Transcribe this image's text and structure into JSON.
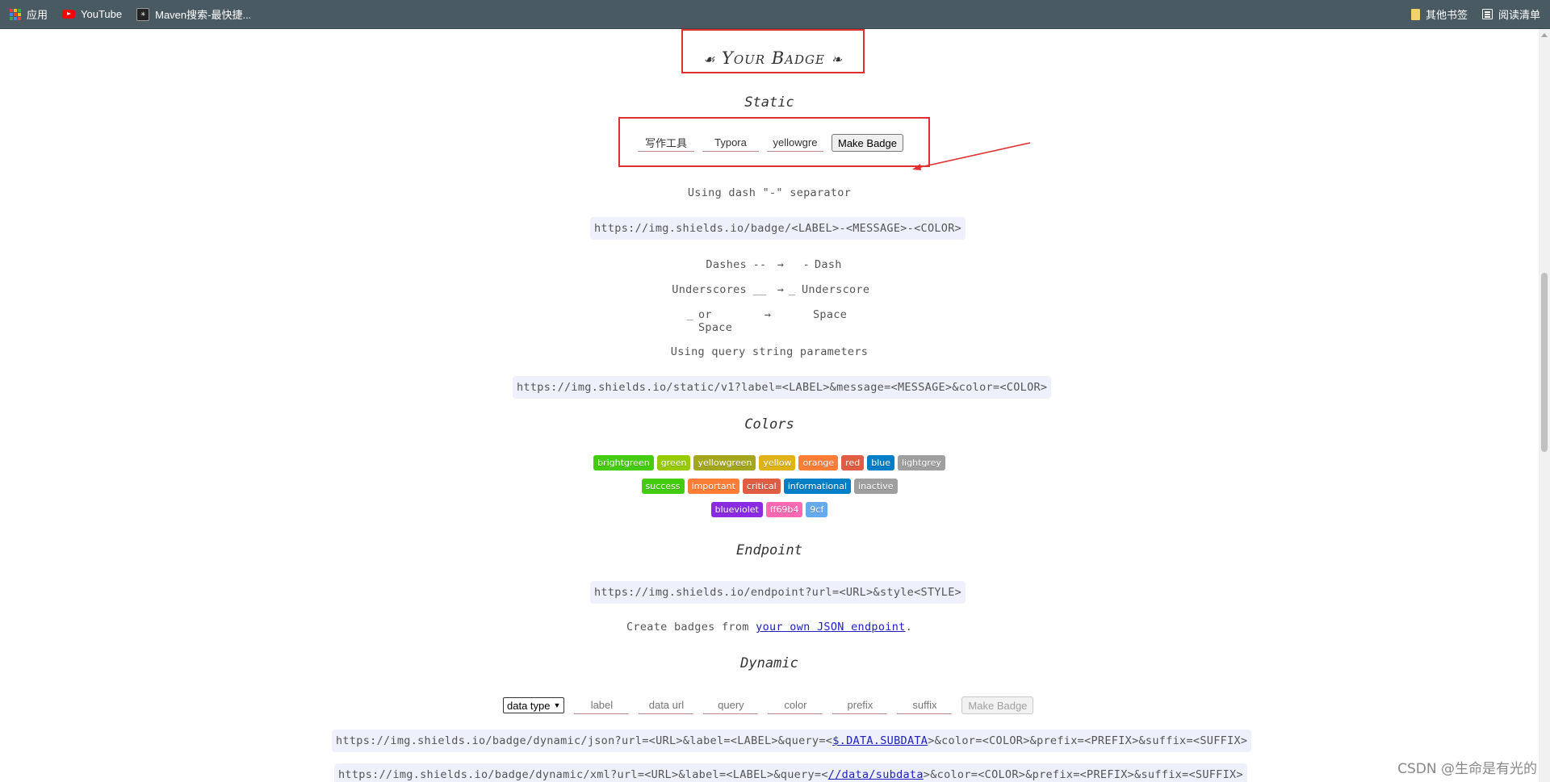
{
  "bookmarks": {
    "apps": "应用",
    "youtube": "YouTube",
    "maven": "Maven搜索-最快捷...",
    "other": "其他书签",
    "reading": "阅读清单"
  },
  "page": {
    "title": "Your Badge",
    "title_left_deco": "☙",
    "title_right_deco": "❧",
    "static_heading": "Static",
    "static_form": {
      "label_value": "写作工具",
      "message_value": "Typora",
      "color_value": "yellowgre",
      "button": "Make Badge"
    },
    "dash_intro": "Using dash \"-\" separator",
    "dash_url": "https://img.shields.io/badge/<LABEL>-<MESSAGE>-<COLOR>",
    "rules": [
      {
        "left": "Dashes",
        "from": "--",
        "arrow": "→",
        "to": "-",
        "right": "Dash"
      },
      {
        "left": "Underscores",
        "from": "__",
        "arrow": "→",
        "to": "_",
        "right": "Underscore"
      },
      {
        "left": "or Space",
        "from": "_",
        "arrow": "→",
        "to": "",
        "right": "Space"
      }
    ],
    "query_intro": "Using query string parameters",
    "query_url": "https://img.shields.io/static/v1?label=<LABEL>&message=<MESSAGE>&color=<COLOR>",
    "colors_heading": "Colors",
    "badges_row1": [
      {
        "text": "brightgreen",
        "color": "#44cc11"
      },
      {
        "text": "green",
        "color": "#97ca00"
      },
      {
        "text": "yellowgreen",
        "color": "#a4a61d"
      },
      {
        "text": "yellow",
        "color": "#dfb317"
      },
      {
        "text": "orange",
        "color": "#fe7d37"
      },
      {
        "text": "red",
        "color": "#e05d44"
      },
      {
        "text": "blue",
        "color": "#007ec6"
      },
      {
        "text": "lightgrey",
        "color": "#9f9f9f"
      }
    ],
    "badges_row2": [
      {
        "text": "success",
        "color": "#44cc11"
      },
      {
        "text": "important",
        "color": "#fe7d37"
      },
      {
        "text": "critical",
        "color": "#e05d44"
      },
      {
        "text": "informational",
        "color": "#007ec6"
      },
      {
        "text": "inactive",
        "color": "#9f9f9f"
      }
    ],
    "badges_row3": [
      {
        "text": "blueviolet",
        "color": "#8a2be2"
      },
      {
        "text": "ff69b4",
        "color": "#ff69b4"
      },
      {
        "text": "9cf",
        "color": "#66aaee"
      }
    ],
    "endpoint_heading": "Endpoint",
    "endpoint_url": "https://img.shields.io/endpoint?url=<URL>&style<STYLE>",
    "endpoint_text_before": "Create badges from ",
    "endpoint_link": "your own JSON endpoint",
    "endpoint_text_after": ".",
    "dynamic_heading": "Dynamic",
    "dynamic_form": {
      "select": "data type",
      "label": "label",
      "data_url": "data url",
      "query": "query",
      "color": "color",
      "prefix": "prefix",
      "suffix": "suffix",
      "button": "Make Badge"
    },
    "dynamic_json": {
      "before": "https://img.shields.io/badge/dynamic/json?url=<URL>&label=<LABEL>&query=<",
      "link": "$.DATA.SUBDATA",
      "after": ">&color=<COLOR>&prefix=<PREFIX>&suffix=<SUFFIX>"
    },
    "dynamic_xml": {
      "before": "https://img.shields.io/badge/dynamic/xml?url=<URL>&label=<LABEL>&query=<",
      "link": "//data/subdata",
      "after": ">&color=<COLOR>&prefix=<PREFIX>&suffix=<SUFFIX>"
    }
  },
  "watermark": "CSDN @生命是有光的",
  "colors": {
    "highlight_box": "#e03030",
    "code_bg": "#eef0fb",
    "link": "#2020c0"
  }
}
